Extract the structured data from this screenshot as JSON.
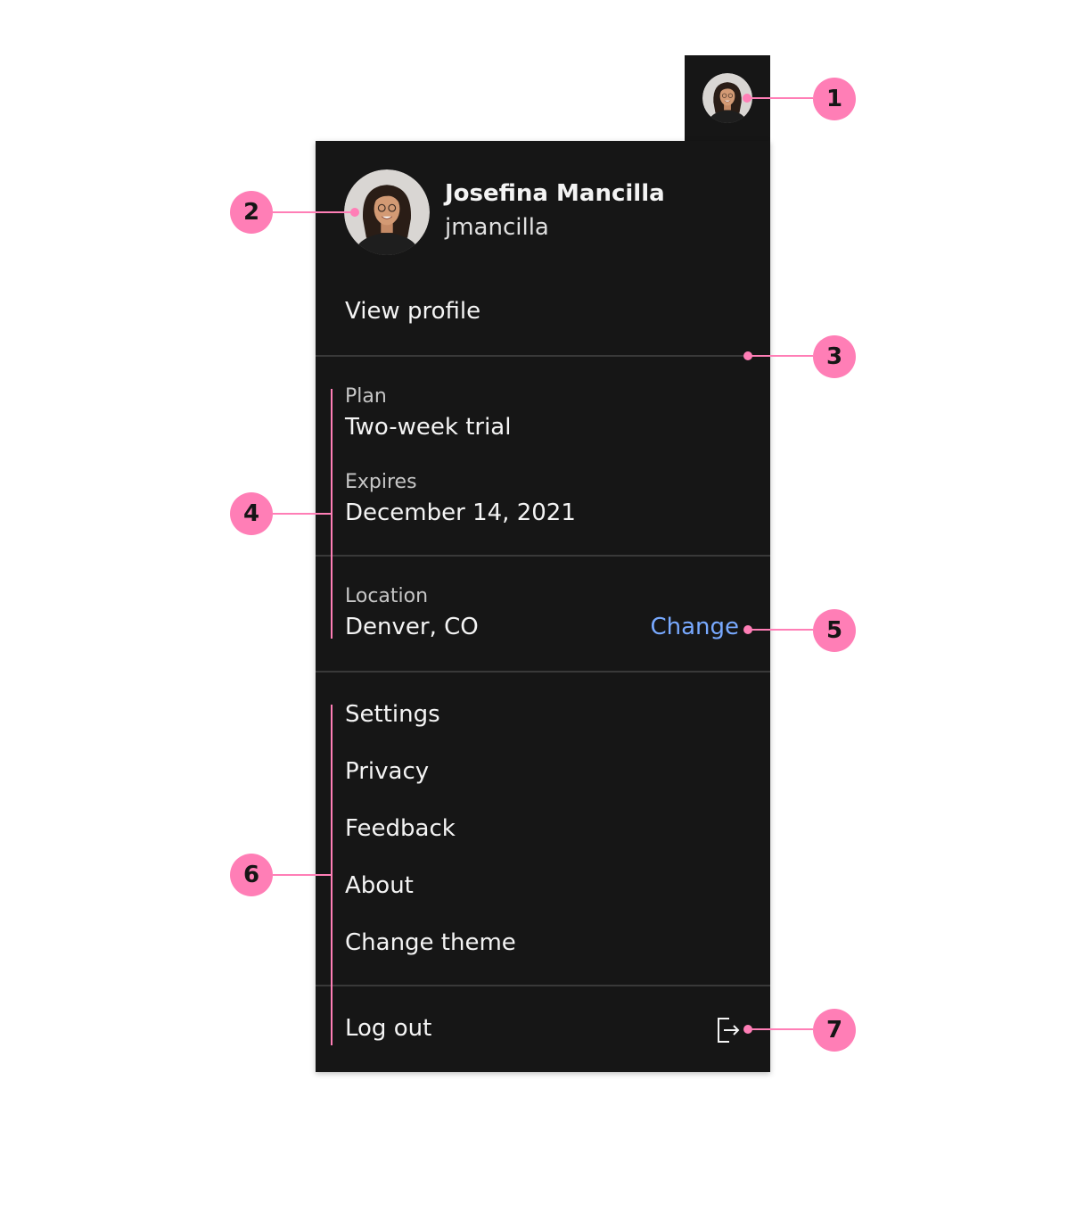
{
  "user": {
    "name": "Josefina Mancilla",
    "handle": "jmancilla",
    "view_profile": "View profile"
  },
  "plan": {
    "label": "Plan",
    "value": "Two-week trial",
    "expires_label": "Expires",
    "expires_value": "December 14, 2021"
  },
  "location": {
    "label": "Location",
    "value": "Denver, CO",
    "change": "Change"
  },
  "menu": [
    "Settings",
    "Privacy",
    "Feedback",
    "About",
    "Change theme"
  ],
  "logout": {
    "label": "Log out",
    "icon": "logout-icon"
  },
  "annotations": [
    "1",
    "2",
    "3",
    "4",
    "5",
    "6",
    "7"
  ],
  "colors": {
    "panel": "#161616",
    "text": "#f4f4f4",
    "secondary": "#c6c6c6",
    "link": "#78a9ff",
    "annotation": "#ff7eb6",
    "divider": "#393939"
  }
}
